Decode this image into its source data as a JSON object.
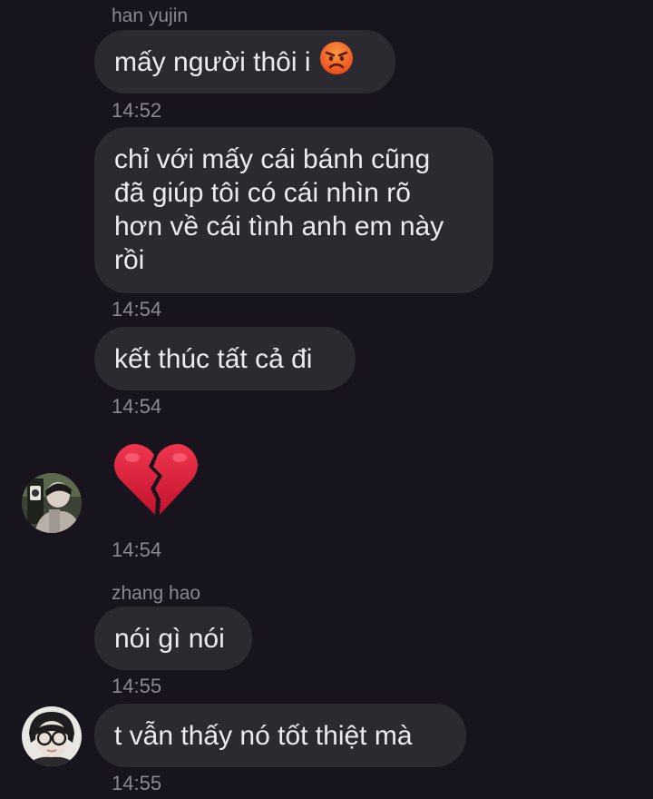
{
  "messages": [
    {
      "sender": "han yujin",
      "text": "mấy người thôi i",
      "emoji": "angry-face",
      "time": "14:52"
    },
    {
      "lines": [
        "chỉ với mấy cái bánh cũng",
        "đã giúp tôi có cái nhìn rõ",
        "hơn về cái tình anh em này",
        "rồi"
      ],
      "time": "14:54"
    },
    {
      "text": "kết thúc tất cả đi",
      "time": "14:54"
    },
    {
      "emoji": "broken-heart",
      "time": "14:54"
    },
    {
      "sender": "zhang hao",
      "text": "nói gì nói",
      "time": "14:55"
    },
    {
      "text": "t vẫn thấy nó tốt thiệt mà",
      "time": "14:55"
    }
  ],
  "colors": {
    "background": "#17141d",
    "bubble": "#2b2a31",
    "meta_text": "#8a8893",
    "message_text": "#ececf0",
    "heart_red": "#d8183a"
  }
}
